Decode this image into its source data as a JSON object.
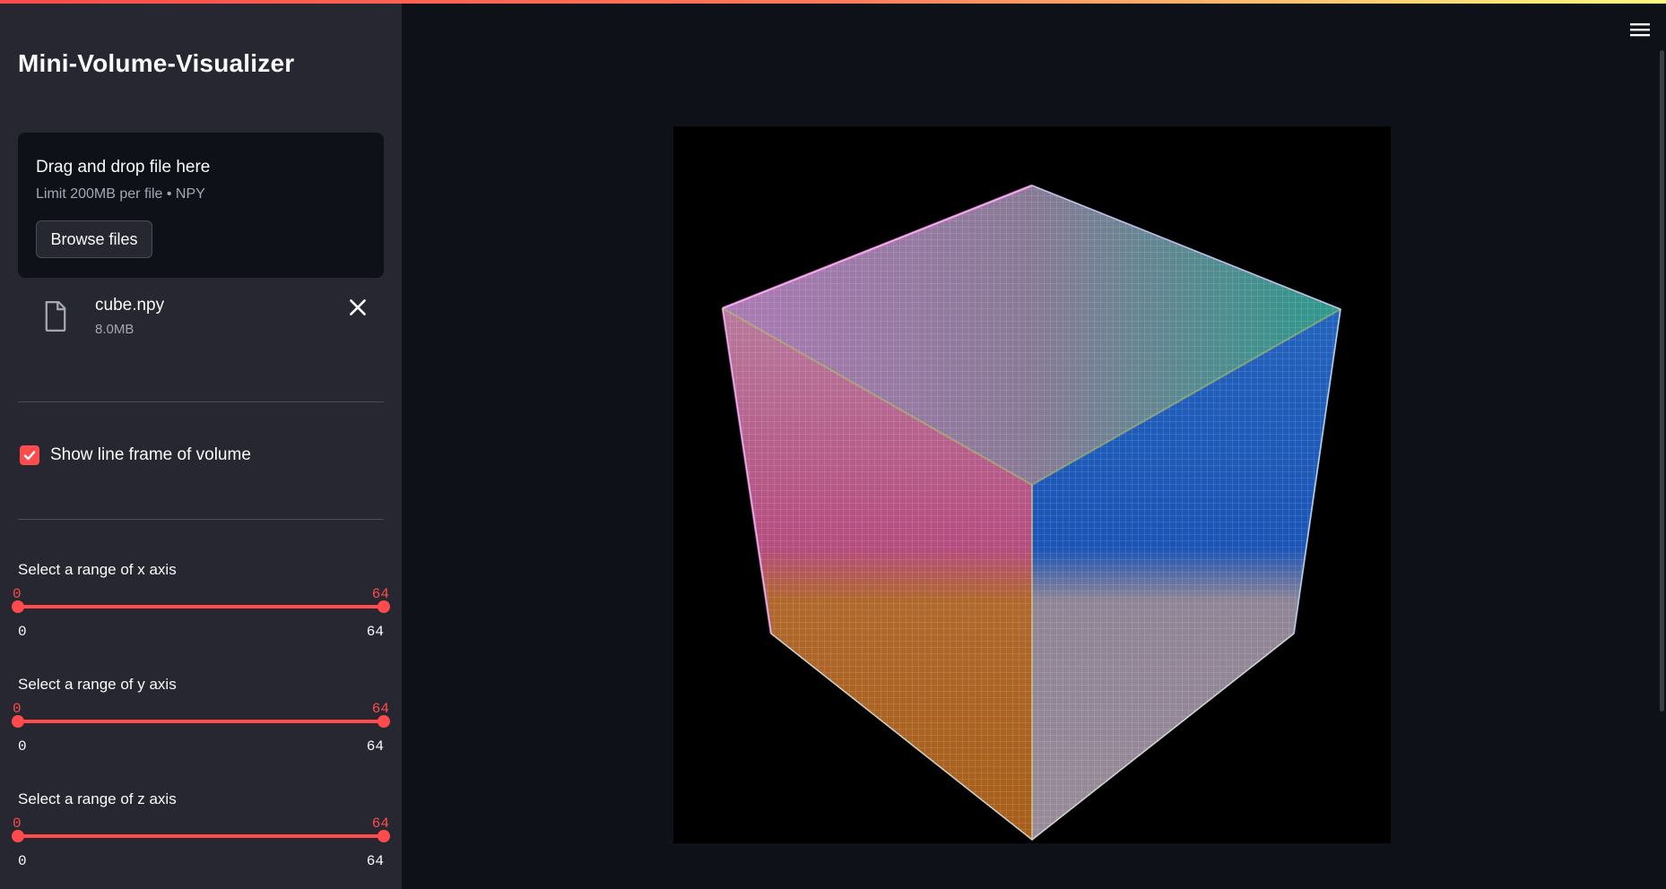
{
  "app": {
    "title": "Mini-Volume-Visualizer"
  },
  "uploader": {
    "drop_text": "Drag and drop file here",
    "limit_text": "Limit 200MB per file • NPY",
    "browse_label": "Browse files"
  },
  "file": {
    "name": "cube.npy",
    "size": "8.0MB"
  },
  "checkbox": {
    "label": "Show line frame of volume",
    "checked": true
  },
  "sliders": [
    {
      "label": "Select a range of x axis",
      "low": "0",
      "high": "64",
      "min": "0",
      "max": "64"
    },
    {
      "label": "Select a range of y axis",
      "low": "0",
      "high": "64",
      "min": "0",
      "max": "64"
    },
    {
      "label": "Select a range of z axis",
      "low": "0",
      "high": "64",
      "min": "0",
      "max": "64"
    }
  ],
  "colors": {
    "accent": "#ff4b4b",
    "sidebar_bg": "#262730",
    "main_bg": "#0e1117",
    "face_top_left": "#c58bd2",
    "face_top_right": "#3fb6a8",
    "face_left_top": "#e0609c",
    "face_left_bottom": "#d4781f",
    "face_right_top": "#1f6fe0",
    "face_right_bottom": "#b8a8b8"
  },
  "icons": {
    "file": "file-icon",
    "close": "close-icon",
    "menu": "hamburger-menu-icon",
    "check": "check-icon"
  }
}
